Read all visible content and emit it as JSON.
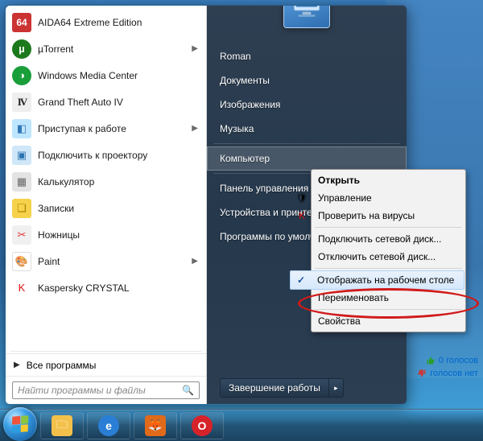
{
  "start_menu": {
    "programs": [
      {
        "label": "AIDA64 Extreme Edition",
        "icon": "64",
        "cls": "ic-aida",
        "sub": false
      },
      {
        "label": "µTorrent",
        "icon": "µ",
        "cls": "ic-ut",
        "sub": true
      },
      {
        "label": "Windows Media Center",
        "icon": "◑",
        "cls": "ic-wmc",
        "sub": false
      },
      {
        "label": "Grand Theft Auto IV",
        "icon": "IV",
        "cls": "ic-gta",
        "sub": false
      },
      {
        "label": "Приступая к работе",
        "icon": "◧",
        "cls": "ic-start",
        "sub": true
      },
      {
        "label": "Подключить к проектору",
        "icon": "▣",
        "cls": "ic-proj",
        "sub": false
      },
      {
        "label": "Калькулятор",
        "icon": "▦",
        "cls": "ic-calc",
        "sub": false
      },
      {
        "label": "Записки",
        "icon": "❏",
        "cls": "ic-notes",
        "sub": false
      },
      {
        "label": "Ножницы",
        "icon": "✂",
        "cls": "ic-snip",
        "sub": false
      },
      {
        "label": "Paint",
        "icon": "🎨",
        "cls": "ic-paint",
        "sub": true
      },
      {
        "label": "Kaspersky CRYSTAL",
        "icon": "K",
        "cls": "ic-kasp",
        "sub": false
      }
    ],
    "all_programs": "Все программы",
    "search_placeholder": "Найти программы и файлы",
    "right_items": [
      "Roman",
      "Документы",
      "Изображения",
      "Музыка",
      "—",
      "Компьютер",
      "—",
      "Панель управления",
      "Устройства и принтеры",
      "Программы по умолчанию"
    ],
    "right_hover_index": 5,
    "shutdown_label": "Завершение работы"
  },
  "context_menu": {
    "items": [
      {
        "label": "Открыть",
        "bold": true
      },
      {
        "label": "Управление",
        "icon": "🛡"
      },
      {
        "label": "Проверить на вирусы",
        "icon": "K",
        "iconColor": "#d11"
      },
      {
        "sep": true
      },
      {
        "label": "Подключить сетевой диск..."
      },
      {
        "label": "Отключить сетевой диск..."
      },
      {
        "sep": true
      },
      {
        "label": "Отображать на рабочем столе",
        "checked": true,
        "hover": true
      },
      {
        "label": "Переименовать"
      },
      {
        "sep": true
      },
      {
        "label": "Свойства"
      }
    ]
  },
  "votes": {
    "up": "0 голосов",
    "down": "голосов нет"
  },
  "taskbar": {
    "apps": [
      {
        "name": "explorer-icon",
        "bg": "#f3c14b",
        "glyph": "🗀"
      },
      {
        "name": "ie-icon",
        "bg": "#2a7ed6",
        "glyph": "e"
      },
      {
        "name": "firefox-icon",
        "bg": "#e06a1a",
        "glyph": "🦊"
      },
      {
        "name": "opera-icon",
        "bg": "#d6232a",
        "glyph": "O"
      }
    ]
  }
}
